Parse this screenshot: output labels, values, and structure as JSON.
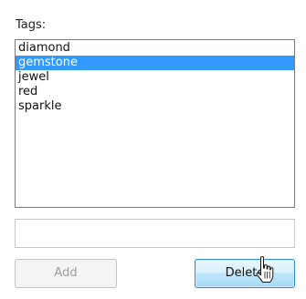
{
  "tags": {
    "label": "Tags:",
    "items": [
      "diamond",
      "gemstone",
      "jewel",
      "red",
      "sparkle"
    ],
    "selected": "gemstone"
  },
  "tag_input": {
    "value": "",
    "placeholder": ""
  },
  "buttons": {
    "add": "Add",
    "delete": "Delete"
  },
  "colors": {
    "selection": "#3399ff",
    "delete_border": "#2f8fd8"
  },
  "cursor": {
    "icon": "hand-pointer-icon"
  }
}
